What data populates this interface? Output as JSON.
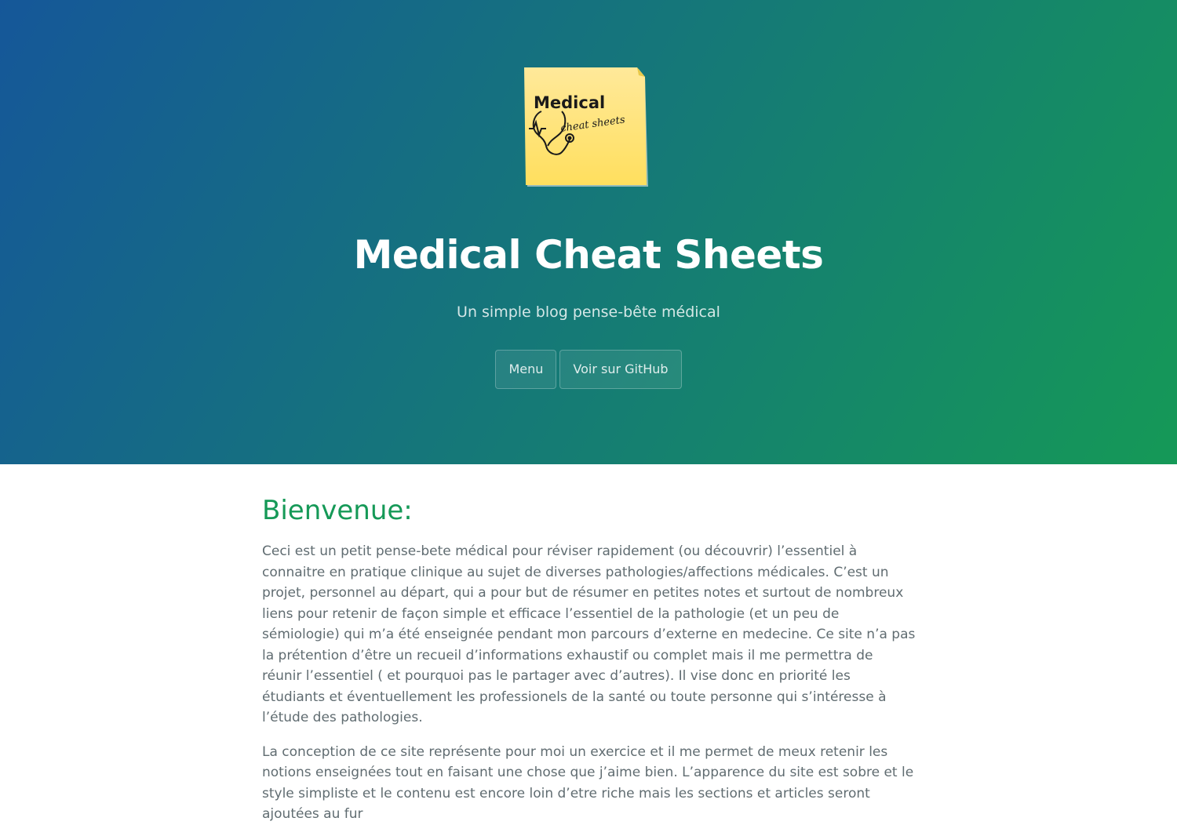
{
  "header": {
    "logo": {
      "text_main": "Medical",
      "text_script": "cheat sheets",
      "icon": "stethoscope-icon",
      "note_color": "#ffe066"
    },
    "title": "Medical Cheat Sheets",
    "tagline": "Un simple blog pense-bête médical",
    "buttons": {
      "menu": "Menu",
      "github": "Voir sur GitHub"
    },
    "gradient": [
      "#155799",
      "#159957"
    ]
  },
  "main": {
    "heading": "Bienvenue:",
    "paragraphs": [
      "Ceci est un petit pense-bete médical pour réviser rapidement (ou découvrir) l’essentiel à connaitre en pratique clinique au sujet de diverses pathologies/affections médicales. C’est un projet, personnel au départ, qui a pour but de résumer en petites notes et surtout de nombreux liens pour retenir de façon simple et efficace l’essentiel de la pathologie (et un peu de sémiologie) qui m’a été enseignée pendant mon parcours d’externe en medecine. Ce site n’a pas la prétention d’être un recueil d’informations exhaustif ou complet mais il me permettra de réunir l’essentiel ( et pourquoi pas le partager avec d’autres). Il vise donc en priorité les étudiants et éventuellement les professionels de la santé ou toute personne qui s’intéresse à l’étude des pathologies.",
      "La conception de ce site représente pour moi un exercice et il me permet de meux retenir les notions enseignées tout en faisant une chose que j’aime bien. L’apparence du site est sobre et le style simpliste et le contenu est encore loin d’etre riche mais les sections et articles seront ajoutées au fur"
    ],
    "heading_color": "#159957",
    "text_color": "#606c71"
  }
}
